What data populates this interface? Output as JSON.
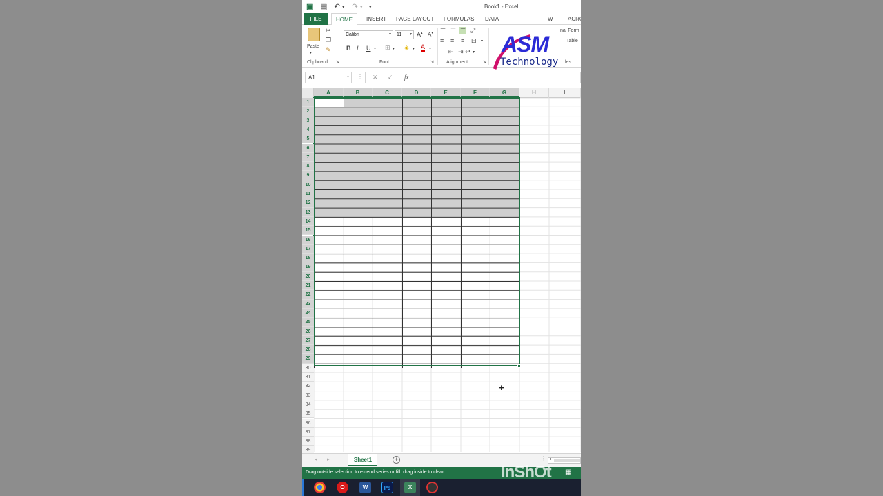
{
  "window": {
    "title": "Book1 - Excel"
  },
  "tabs": [
    {
      "label": "FILE"
    },
    {
      "label": "HOME"
    },
    {
      "label": "INSERT"
    },
    {
      "label": "PAGE LAYOUT"
    },
    {
      "label": "FORMULAS"
    },
    {
      "label": "DATA"
    },
    {
      "label": "W"
    },
    {
      "label": "ACRO"
    }
  ],
  "ribbon": {
    "paste_label": "Paste",
    "font_name": "Calibri",
    "font_size": "11",
    "bold": "B",
    "italic": "I",
    "underline": "U",
    "groups": {
      "clipboard": "Clipboard",
      "font": "Font",
      "alignment": "Alignment",
      "styles": "les"
    },
    "styles_items": [
      "nal Form",
      "Table"
    ]
  },
  "logo": {
    "brand": "ASM",
    "sub": "Technology"
  },
  "formula_bar": {
    "name_box": "A1",
    "cancel": "✕",
    "enter": "✓",
    "fx": "fx",
    "value": ""
  },
  "columns": [
    "A",
    "B",
    "C",
    "D",
    "E",
    "F",
    "G",
    "H",
    "I"
  ],
  "rows": [
    "1",
    "2",
    "3",
    "4",
    "5",
    "6",
    "7",
    "8",
    "9",
    "10",
    "11",
    "12",
    "13",
    "14",
    "15",
    "16",
    "17",
    "18",
    "19",
    "20",
    "21",
    "22",
    "23",
    "24",
    "25",
    "26",
    "27",
    "28",
    "29",
    "30",
    "31",
    "32",
    "33",
    "34",
    "35",
    "36",
    "37",
    "38",
    "39"
  ],
  "sheets": {
    "active": "Sheet1",
    "add": "+"
  },
  "status": {
    "message": "Drag outside selection to extend series or fill; drag inside to clear"
  },
  "watermark": "InShOt",
  "colors": {
    "excel_green": "#217346",
    "selection_gray": "#cfcfcf",
    "logo_blue": "#2b2bd6"
  },
  "taskbar_icons": [
    "chrome-icon",
    "opera-icon",
    "word-icon",
    "photoshop-icon",
    "excel-icon",
    "app-icon"
  ]
}
